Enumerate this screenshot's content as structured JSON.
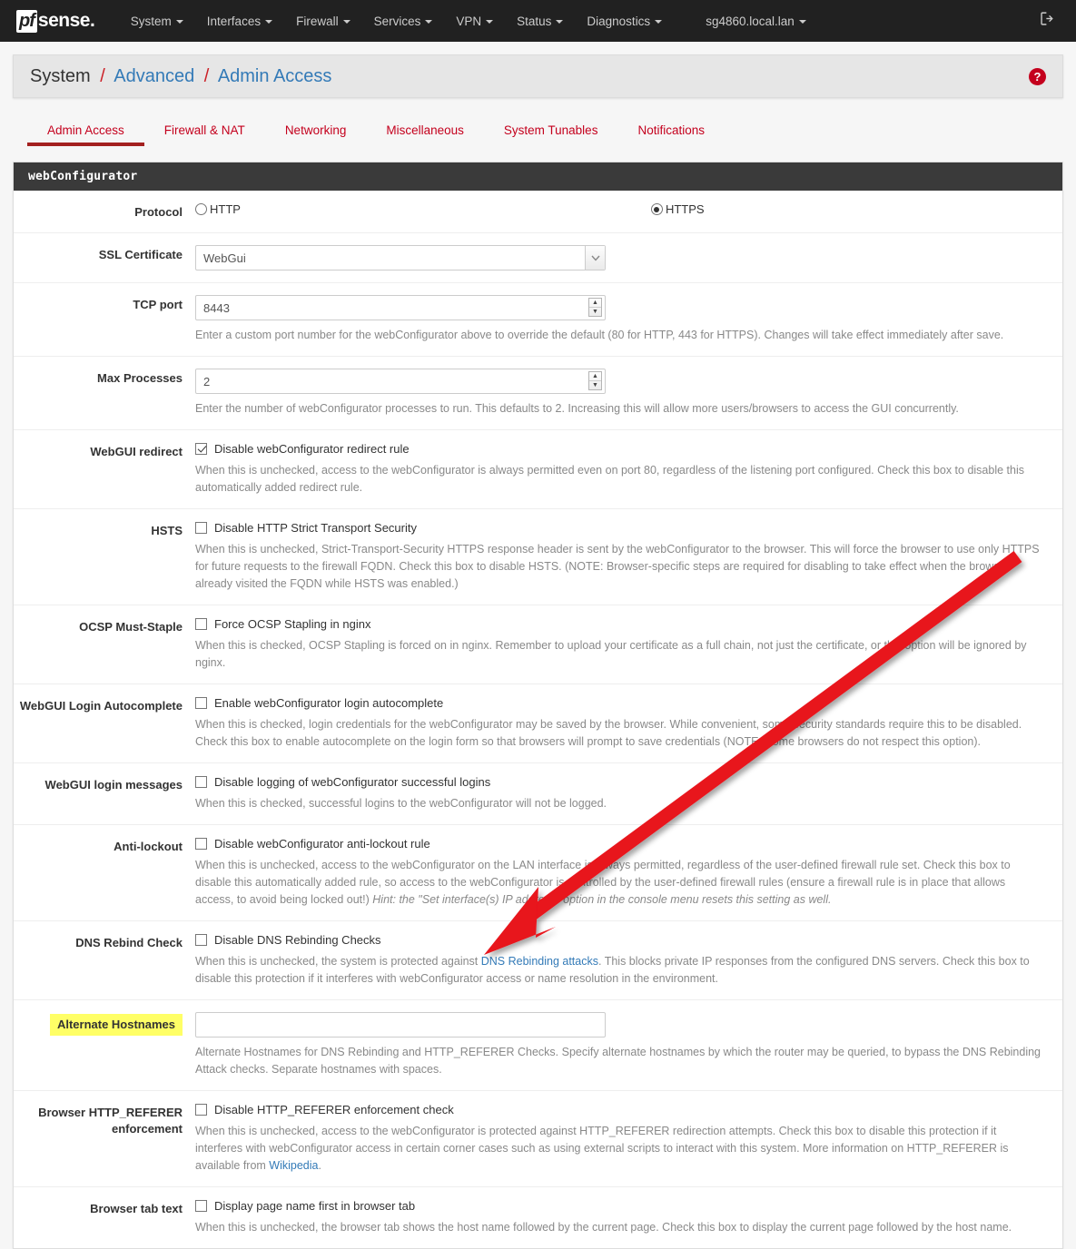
{
  "navbar": {
    "brand_pf": "pf",
    "brand_sense": "sense",
    "items": [
      {
        "label": "System"
      },
      {
        "label": "Interfaces"
      },
      {
        "label": "Firewall"
      },
      {
        "label": "Services"
      },
      {
        "label": "VPN"
      },
      {
        "label": "Status"
      },
      {
        "label": "Diagnostics"
      },
      {
        "label": "sg4860.local.lan"
      }
    ],
    "logout_icon": "logout-icon"
  },
  "breadcrumb": {
    "root": "System",
    "sep": "/",
    "level2": "Advanced",
    "level3": "Admin Access",
    "help_icon": "?"
  },
  "tabs": [
    {
      "label": "Admin Access",
      "active": true
    },
    {
      "label": "Firewall & NAT",
      "active": false
    },
    {
      "label": "Networking",
      "active": false
    },
    {
      "label": "Miscellaneous",
      "active": false
    },
    {
      "label": "System Tunables",
      "active": false
    },
    {
      "label": "Notifications",
      "active": false
    }
  ],
  "panel": {
    "title": "webConfigurator"
  },
  "form": {
    "protocol": {
      "label": "Protocol",
      "http_label": "HTTP",
      "https_label": "HTTPS",
      "selected": "HTTPS"
    },
    "ssl_certificate": {
      "label": "SSL Certificate",
      "value": "WebGui",
      "options": [
        "WebGui"
      ]
    },
    "tcp_port": {
      "label": "TCP port",
      "value": "8443",
      "help": "Enter a custom port number for the webConfigurator above to override the default (80 for HTTP, 443 for HTTPS). Changes will take effect immediately after save."
    },
    "max_processes": {
      "label": "Max Processes",
      "value": "2",
      "help": "Enter the number of webConfigurator processes to run. This defaults to 2. Increasing this will allow more users/browsers to access the GUI concurrently."
    },
    "webgui_redirect": {
      "label": "WebGUI redirect",
      "checkbox_label": "Disable webConfigurator redirect rule",
      "checked": true,
      "help": "When this is unchecked, access to the webConfigurator is always permitted even on port 80, regardless of the listening port configured. Check this box to disable this automatically added redirect rule."
    },
    "hsts": {
      "label": "HSTS",
      "checkbox_label": "Disable HTTP Strict Transport Security",
      "checked": false,
      "help": "When this is unchecked, Strict-Transport-Security HTTPS response header is sent by the webConfigurator to the browser. This will force the browser to use only HTTPS for future requests to the firewall FQDN. Check this box to disable HSTS. (NOTE: Browser-specific steps are required for disabling to take effect when the browser already visited the FQDN while HSTS was enabled.)"
    },
    "ocsp_must_staple": {
      "label": "OCSP Must-Staple",
      "checkbox_label": "Force OCSP Stapling in nginx",
      "checked": false,
      "help": "When this is checked, OCSP Stapling is forced on in nginx. Remember to upload your certificate as a full chain, not just the certificate, or this option will be ignored by nginx."
    },
    "login_autocomplete": {
      "label": "WebGUI Login Autocomplete",
      "checkbox_label": "Enable webConfigurator login autocomplete",
      "checked": false,
      "help": "When this is checked, login credentials for the webConfigurator may be saved by the browser. While convenient, some security standards require this to be disabled. Check this box to enable autocomplete on the login form so that browsers will prompt to save credentials (NOTE: Some browsers do not respect this option)."
    },
    "login_messages": {
      "label": "WebGUI login messages",
      "checkbox_label": "Disable logging of webConfigurator successful logins",
      "checked": false,
      "help": "When this is checked, successful logins to the webConfigurator will not be logged."
    },
    "anti_lockout": {
      "label": "Anti-lockout",
      "checkbox_label": "Disable webConfigurator anti-lockout rule",
      "checked": false,
      "help_part1": "When this is unchecked, access to the webConfigurator on the LAN interface is always permitted, regardless of the user-defined firewall rule set. Check this box to disable this automatically added rule, so access to the webConfigurator is controlled by the user-defined firewall rules (ensure a firewall rule is in place that allows access, to avoid being locked out!) ",
      "help_italic": "Hint: the \"Set interface(s) IP address\" option in the console menu resets this setting as well."
    },
    "dns_rebind": {
      "label": "DNS Rebind Check",
      "checkbox_label": "Disable DNS Rebinding Checks",
      "checked": false,
      "help_part1": "When this is unchecked, the system is protected against ",
      "help_link": "DNS Rebinding attacks",
      "help_part2": ". This blocks private IP responses from the configured DNS servers. Check this box to disable this protection if it interferes with webConfigurator access or name resolution in the environment."
    },
    "alternate_hostnames": {
      "label": "Alternate Hostnames",
      "highlighted": true,
      "value": "",
      "help": "Alternate Hostnames for DNS Rebinding and HTTP_REFERER Checks. Specify alternate hostnames by which the router may be queried, to bypass the DNS Rebinding Attack checks. Separate hostnames with spaces."
    },
    "http_referer": {
      "label_line1": "Browser HTTP_REFERER",
      "label_line2": "enforcement",
      "checkbox_label": "Disable HTTP_REFERER enforcement check",
      "checked": false,
      "help_part1": "When this is unchecked, access to the webConfigurator is protected against HTTP_REFERER redirection attempts. Check this box to disable this protection if it interferes with webConfigurator access in certain corner cases such as using external scripts to interact with this system. More information on HTTP_REFERER is available from ",
      "help_link": "Wikipedia",
      "help_part2": "."
    },
    "browser_tab_text": {
      "label": "Browser tab text",
      "checkbox_label": "Display page name first in browser tab",
      "checked": false,
      "help": "When this is unchecked, the browser tab shows the host name followed by the current page. Check this box to display the current page followed by the host name."
    }
  },
  "annotation": {
    "arrow_color": "#e8121b",
    "type": "arrow"
  }
}
